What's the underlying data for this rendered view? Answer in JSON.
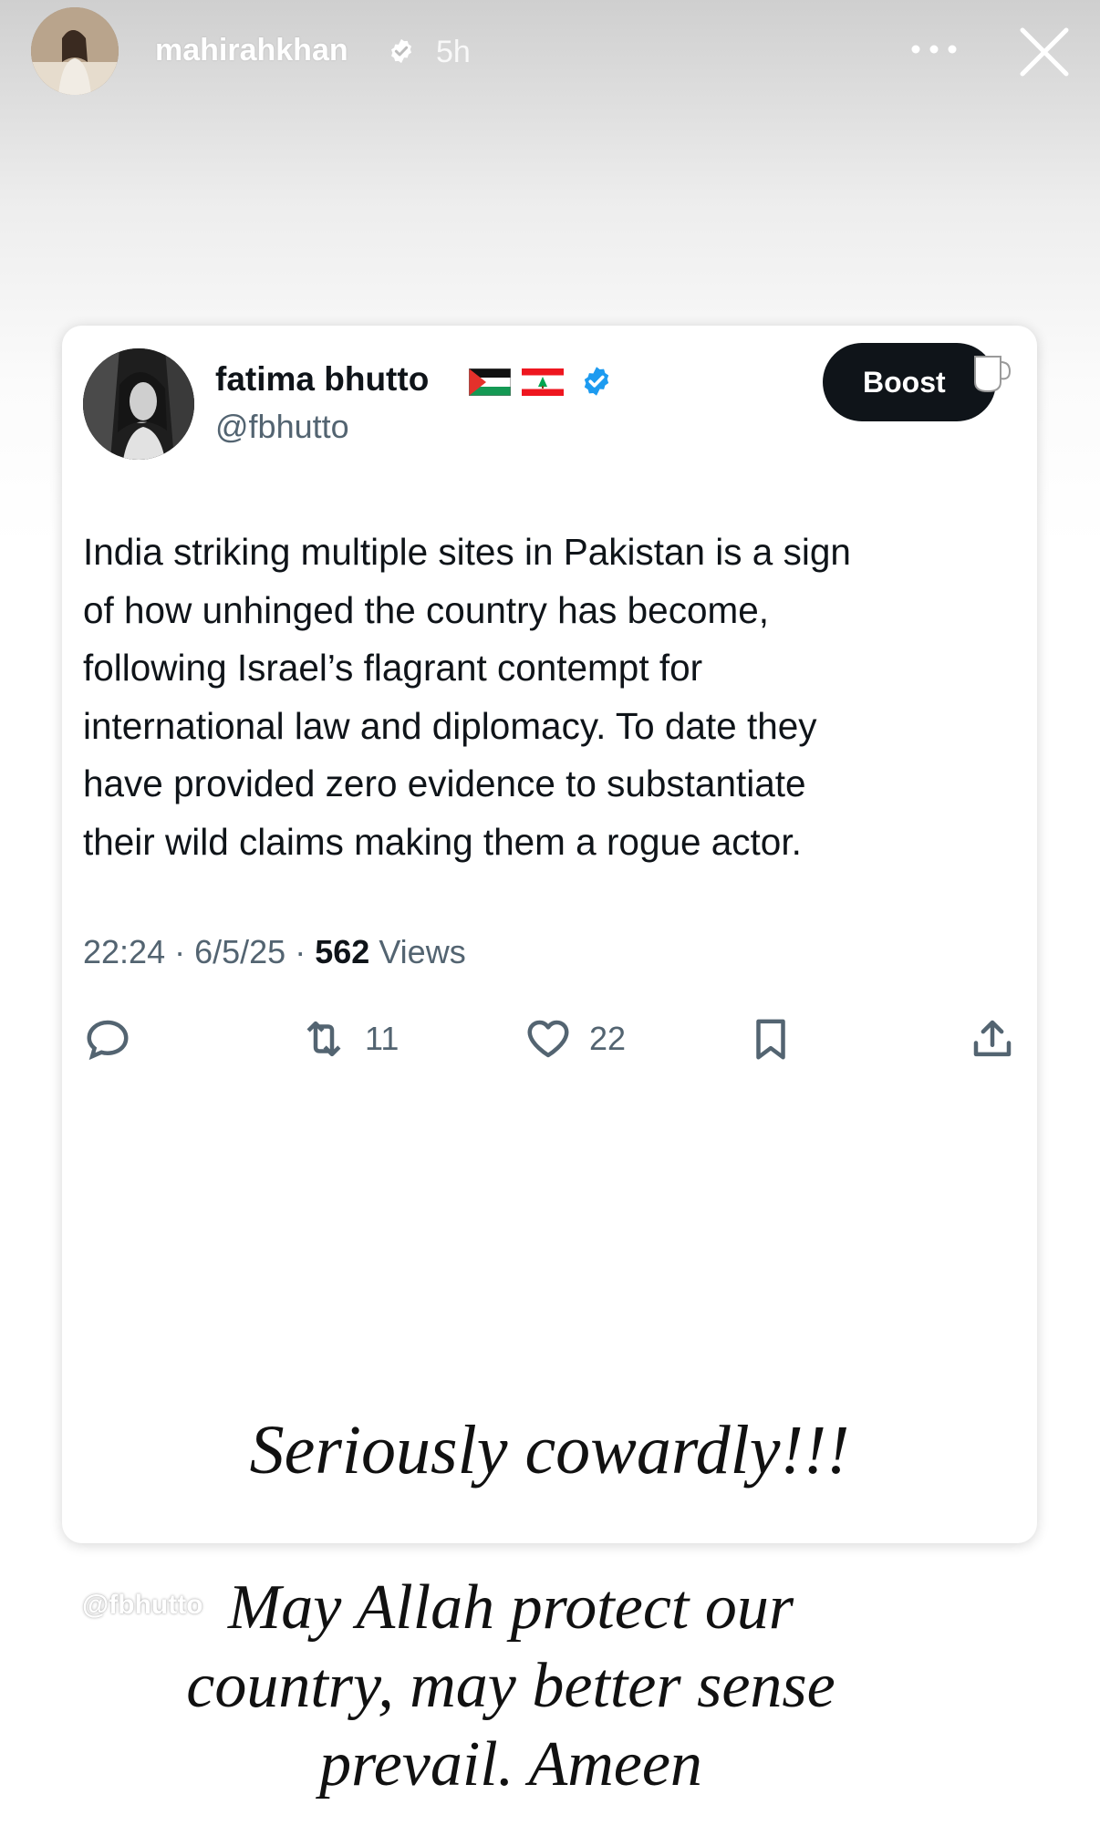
{
  "story": {
    "username": "mahirahkhan",
    "time_ago": "5h"
  },
  "tweet": {
    "display_name": "fatima bhutto",
    "flags": [
      "palestine-flag",
      "lebanon-flag"
    ],
    "handle": "@fbhutto",
    "boost_label": "Boost",
    "text": "India striking multiple sites in Pakistan is a sign\nof how unhinged the country has become,\nfollowing Israel’s flagrant contempt for\ninternational law and diplomacy. To date they\nhave provided zero evidence to substantiate\ntheir wild claims making them a rogue actor.",
    "time": "22:24",
    "date": "6/5/25",
    "views_count": "562",
    "views_label": "Views",
    "reposts": "11",
    "likes": "22"
  },
  "captions": {
    "line1": "Seriously cowardly!!!",
    "watermark": "@fbhutto",
    "line2": "May Allah protect our\ncountry, may better sense\nprevail. Ameen"
  },
  "colors": {
    "verified_blue": "#1d9bf0",
    "secondary_text": "#536471",
    "boost_bg": "#0f1419"
  }
}
